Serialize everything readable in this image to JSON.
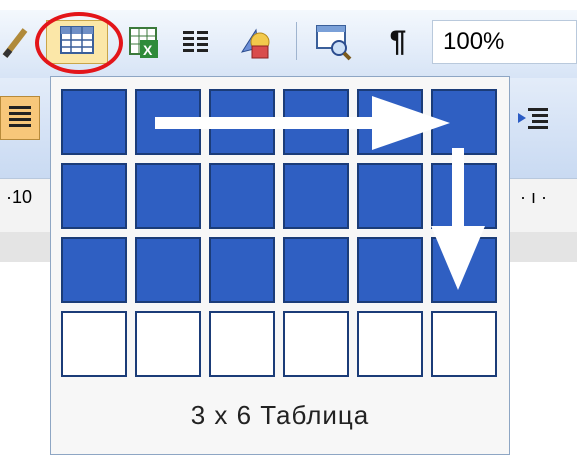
{
  "toolbar": {
    "zoom_value": "100%",
    "pilcrow_glyph": "¶"
  },
  "table_picker": {
    "rows": 4,
    "cols": 6,
    "selected_rows": 3,
    "selected_cols": 6,
    "caption": "3 x 6 Таблица",
    "selected_color": "#2F5FC2",
    "grid_line_color": "#1B3C78"
  },
  "ruler": {
    "left_label": "·10",
    "right_marks": "· ı ·"
  },
  "annotations": {
    "highlight_color": "#E3151A",
    "arrow_color": "#FFFFFF"
  },
  "icons": [
    "pencil-icon",
    "insert-table-icon",
    "insert-excel-sheet-icon",
    "columns-icon",
    "drawing-icon",
    "document-map-icon",
    "show-formatting-icon"
  ]
}
